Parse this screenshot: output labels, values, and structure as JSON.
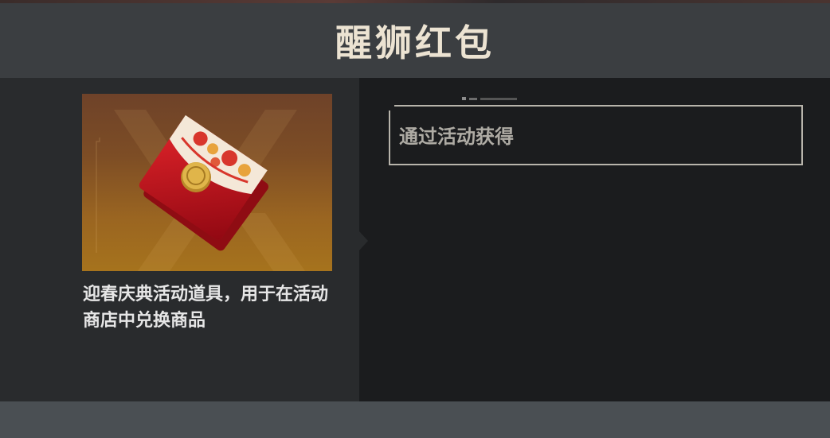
{
  "header": {
    "title": "醒狮红包"
  },
  "item": {
    "description": "迎春庆典活动道具，用于在活动商店中兑换商品",
    "image_icon": "red-envelope-icon"
  },
  "source": {
    "label": "通过活动获得"
  },
  "colors": {
    "header_bg": "#3b3e41",
    "title_text": "#ece3d2",
    "image_bg_top": "#6e4229",
    "image_bg_bottom": "#a6731d",
    "envelope_red": "#c8101c",
    "seal_gold": "#d9ad3c",
    "footer_bg": "#4a4f53"
  }
}
